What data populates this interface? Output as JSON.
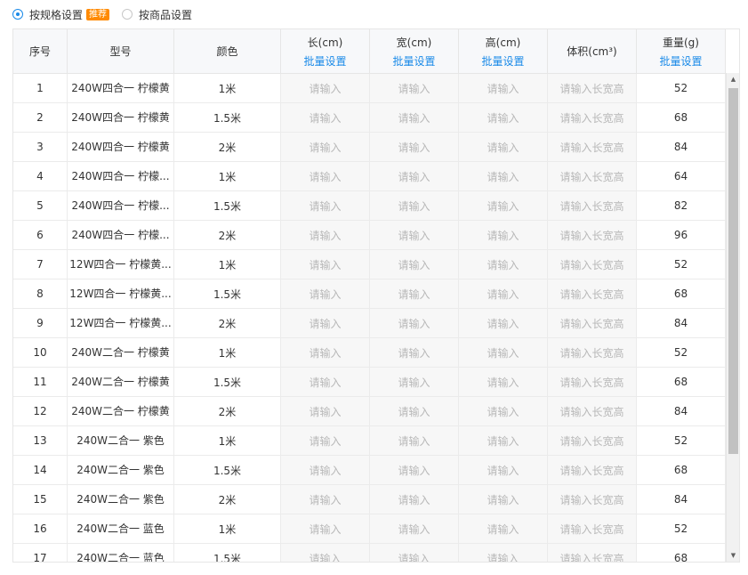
{
  "mode_options": [
    {
      "label": "按规格设置",
      "checked": true,
      "badge": "推荐"
    },
    {
      "label": "按商品设置",
      "checked": false
    }
  ],
  "columns": {
    "index": "序号",
    "model": "型号",
    "color": "颜色",
    "length": "长(cm)",
    "width": "宽(cm)",
    "height": "高(cm)",
    "volume": "体积(cm³)",
    "weight": "重量(g)",
    "batch_label": "批量设置"
  },
  "placeholders": {
    "dimension": "请输入",
    "volume": "请输入长宽高"
  },
  "rows": [
    {
      "index": "1",
      "model": "240W四合一 柠檬黄",
      "color": "1米",
      "weight": "52"
    },
    {
      "index": "2",
      "model": "240W四合一 柠檬黄",
      "color": "1.5米",
      "weight": "68"
    },
    {
      "index": "3",
      "model": "240W四合一 柠檬黄",
      "color": "2米",
      "weight": "84"
    },
    {
      "index": "4",
      "model": "240W四合一 柠檬...",
      "color": "1米",
      "weight": "64"
    },
    {
      "index": "5",
      "model": "240W四合一 柠檬...",
      "color": "1.5米",
      "weight": "82"
    },
    {
      "index": "6",
      "model": "240W四合一 柠檬...",
      "color": "2米",
      "weight": "96"
    },
    {
      "index": "7",
      "model": "12W四合一 柠檬黄...",
      "color": "1米",
      "weight": "52"
    },
    {
      "index": "8",
      "model": "12W四合一 柠檬黄...",
      "color": "1.5米",
      "weight": "68"
    },
    {
      "index": "9",
      "model": "12W四合一 柠檬黄...",
      "color": "2米",
      "weight": "84"
    },
    {
      "index": "10",
      "model": "240W二合一 柠檬黄",
      "color": "1米",
      "weight": "52"
    },
    {
      "index": "11",
      "model": "240W二合一 柠檬黄",
      "color": "1.5米",
      "weight": "68"
    },
    {
      "index": "12",
      "model": "240W二合一 柠檬黄",
      "color": "2米",
      "weight": "84"
    },
    {
      "index": "13",
      "model": "240W二合一 紫色",
      "color": "1米",
      "weight": "52"
    },
    {
      "index": "14",
      "model": "240W二合一 紫色",
      "color": "1.5米",
      "weight": "68"
    },
    {
      "index": "15",
      "model": "240W二合一 紫色",
      "color": "2米",
      "weight": "84"
    },
    {
      "index": "16",
      "model": "240W二合一 蓝色",
      "color": "1米",
      "weight": "52"
    },
    {
      "index": "17",
      "model": "240W二合一 蓝色",
      "color": "1.5米",
      "weight": "68"
    }
  ],
  "colors": {
    "accent": "#1a8ae8",
    "badge": "#ff8a00",
    "header_bg": "#f7f8fa",
    "input_bg": "#f7f7f7",
    "placeholder": "#b8b8b8"
  }
}
